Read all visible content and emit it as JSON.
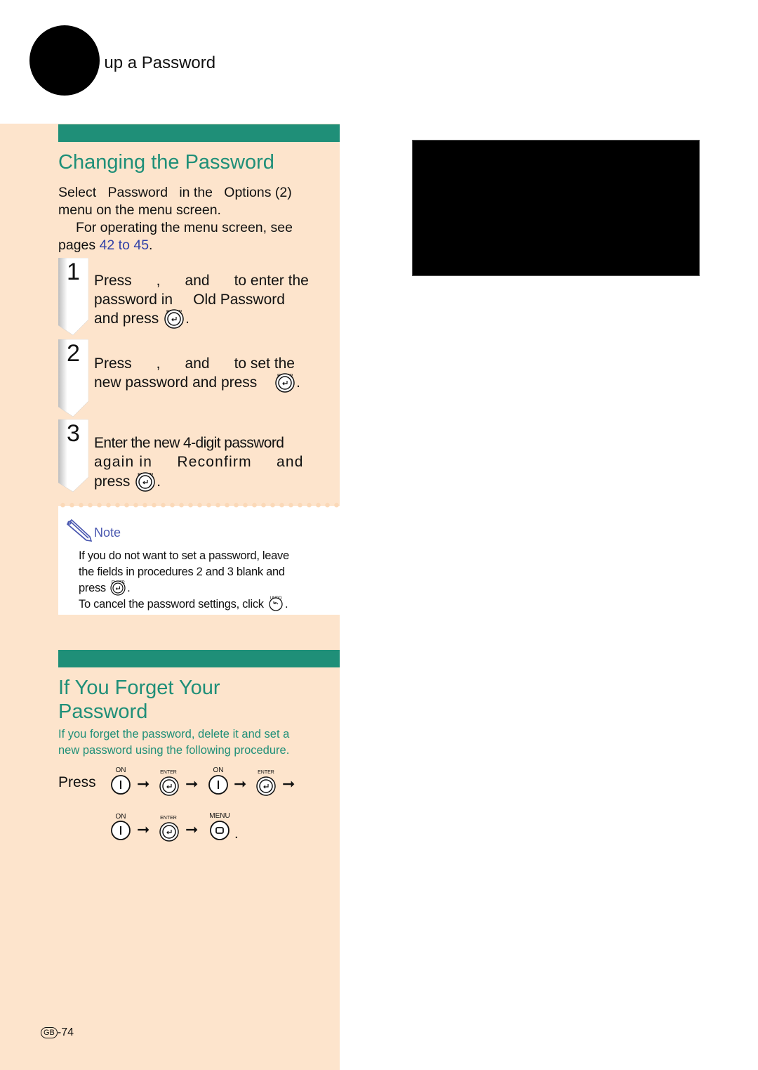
{
  "header": {
    "title": "Setting up a Password",
    "title_visible": "ng up a Password"
  },
  "section1": {
    "heading": "Changing the Password",
    "intro_line1": "Select   Password   in the   Options (2)",
    "intro_line2": "menu on the menu screen.",
    "ref_line1": "For operating the menu screen, see",
    "ref_prefix": "pages",
    "ref_link": "42 to 45",
    "ref_suffix": ".",
    "steps": [
      {
        "number": "1",
        "line1": "Press      ,      and      to enter the",
        "line2": "password in     Old Password",
        "line3": "and press",
        "button": "ENTER"
      },
      {
        "number": "2",
        "line1": "Press      ,      and      to set the",
        "line2": "new password and press",
        "button": "ENTER"
      },
      {
        "number": "3",
        "line1": "Enter the new 4-digit password",
        "line2": "again in     Reconfirm     and",
        "line3": "press",
        "button": "ENTER"
      }
    ]
  },
  "note": {
    "title": "Note",
    "line1": "If you do not want to set a password, leave",
    "line2": "the fields in procedures 2 and 3 blank and",
    "line3": "press",
    "line3_button": "ENTER",
    "line4": "To cancel the password settings, click",
    "line4_button": "UNDO"
  },
  "section2": {
    "heading_line1": "If You Forget Your",
    "heading_line2": "Password",
    "intro_line1": "If you forget the password, delete it and set a",
    "intro_line2": "new password using the following procedure.",
    "press_label": "Press",
    "sequence_row1": [
      "ON",
      "ENTER",
      "ON",
      "ENTER"
    ],
    "sequence_row2": [
      "ON",
      "ENTER",
      "MENU"
    ],
    "period": "."
  },
  "footer": {
    "region_badge": "GB",
    "page_number": "-74"
  },
  "colors": {
    "accent_teal": "#1f8f78",
    "sidebar_bg": "#fde4cc",
    "link_blue": "#3040a8",
    "note_blue": "#4a58b0"
  }
}
